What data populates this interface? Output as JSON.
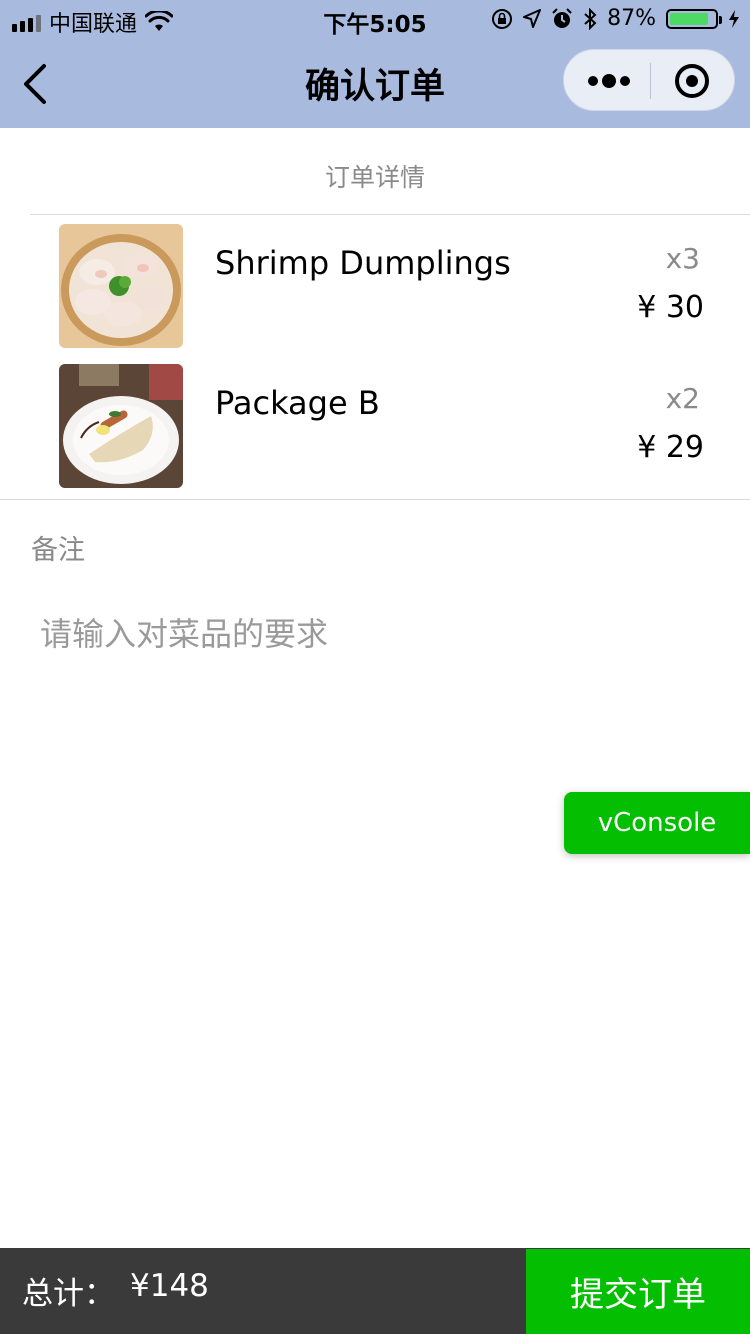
{
  "status_bar": {
    "carrier": "中国联通",
    "time": "下午5:05",
    "battery_percent": "87%",
    "battery_level": 0.87,
    "icons": [
      "signal-icon",
      "wifi-icon",
      "orientation-lock-icon",
      "location-icon",
      "alarm-icon",
      "bluetooth-icon",
      "battery-icon",
      "charging-icon"
    ]
  },
  "nav": {
    "title": "确认订单"
  },
  "order": {
    "section_title": "订单详情",
    "items": [
      {
        "name": "Shrimp Dumplings",
        "qty": "x3",
        "price": "¥ 30",
        "image": "shrimp-dumplings-photo"
      },
      {
        "name": "Package B",
        "qty": "x2",
        "price": "¥ 29",
        "image": "package-b-photo"
      }
    ]
  },
  "remark": {
    "label": "备注",
    "placeholder": "请输入对菜品的要求",
    "value": ""
  },
  "vconsole": {
    "label": "vConsole"
  },
  "footer": {
    "total_label": "总计：",
    "total_value": "¥148",
    "submit_label": "提交订单"
  },
  "colors": {
    "nav_bg": "#a8bbdf",
    "accent_green": "#04be02",
    "footer_bg": "#3a3a3a"
  }
}
